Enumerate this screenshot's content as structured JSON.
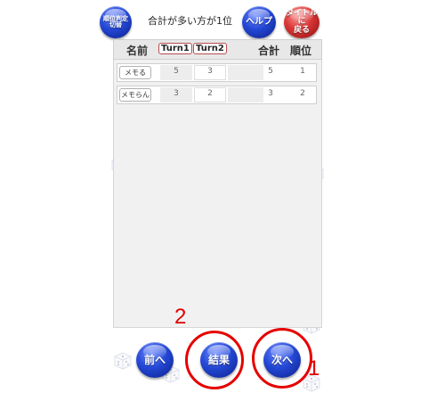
{
  "toolbar": {
    "judge_toggle_label": "順位判定\n切替",
    "rule_text": "合計が多い方が1位",
    "help_label": "ヘルプ",
    "title_back_label": "タイトルに\n戻る"
  },
  "table": {
    "headers": {
      "name": "名前",
      "turn1": "Turn1",
      "turn2": "Turn2",
      "total": "合計",
      "rank": "順位"
    },
    "rows": [
      {
        "name": "メモる",
        "turn1": "5",
        "turn2": "3",
        "total": "5",
        "rank": "1"
      },
      {
        "name": "メモらん",
        "turn1": "3",
        "turn2": "2",
        "total": "3",
        "rank": "2"
      }
    ]
  },
  "nav": {
    "prev_label": "前へ",
    "result_label": "結果",
    "next_label": "次へ"
  },
  "annotations": {
    "result_number": "2",
    "next_number": "1"
  },
  "colors": {
    "button_blue": "#2448d6",
    "button_red": "#d93636",
    "annotation_red": "#e60000",
    "panel_bg": "#f1f1f1"
  }
}
